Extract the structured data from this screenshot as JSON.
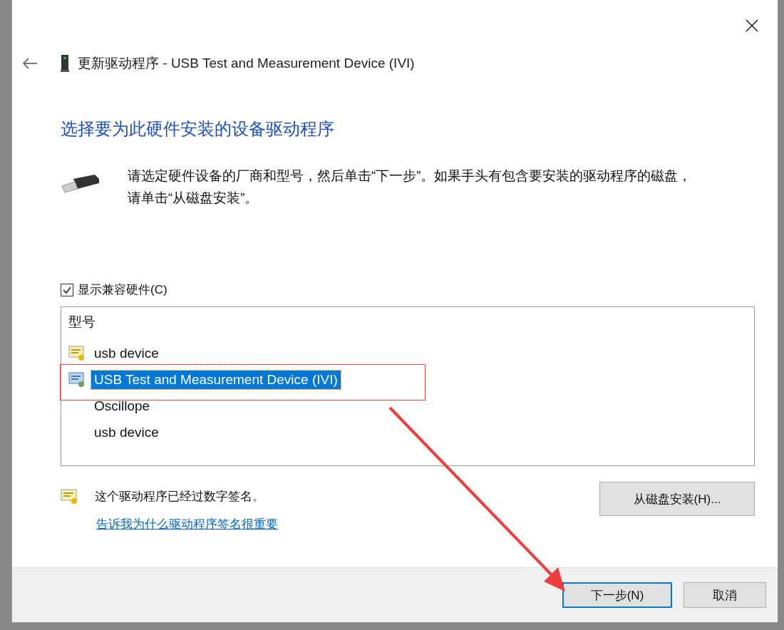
{
  "window": {
    "title": "更新驱动程序 - USB Test and Measurement Device (IVI)"
  },
  "heading": "选择要为此硬件安装的设备驱动程序",
  "description": "请选定硬件设备的厂商和型号，然后单击“下一步”。如果手头有包含要安装的驱动程序的磁盘，请单击“从磁盘安装”。",
  "compatible_checkbox": {
    "label": "显示兼容硬件(C)",
    "checked": true
  },
  "model_list": {
    "header": "型号",
    "items": [
      {
        "label": "usb device",
        "kind": "certificate",
        "selected": false
      },
      {
        "label": "USB Test and Measurement Device (IVI)",
        "kind": "device",
        "selected": true
      },
      {
        "label": "Oscillope",
        "kind": "plain",
        "selected": false
      },
      {
        "label": "usb device",
        "kind": "plain",
        "selected": false
      }
    ]
  },
  "signature_note": "这个驱动程序已经过数字签名。",
  "signature_link": "告诉我为什么驱动程序签名很重要",
  "have_disk_button": "从磁盘安装(H)...",
  "buttons": [
    {
      "label": "下一步(N)",
      "default": true
    },
    {
      "label": "取消",
      "default": false
    }
  ]
}
